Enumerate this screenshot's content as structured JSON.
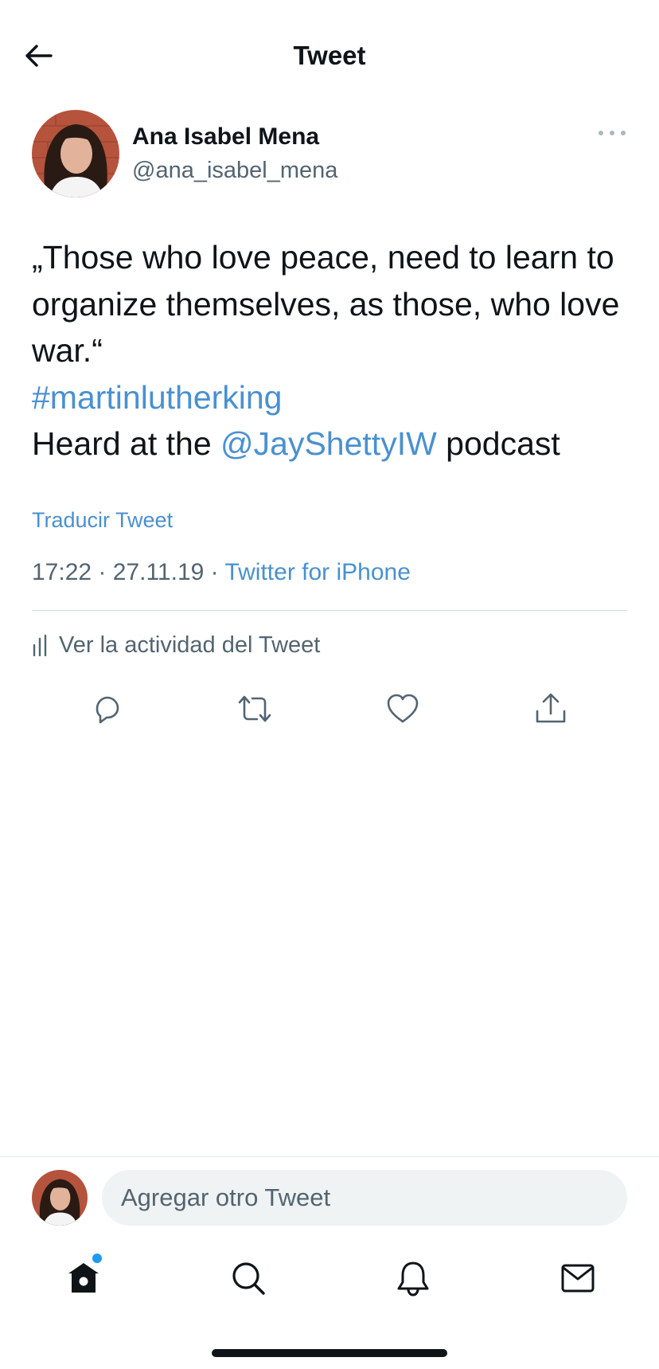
{
  "header": {
    "title": "Tweet"
  },
  "author": {
    "name": "Ana Isabel Mena",
    "handle": "@ana_isabel_mena"
  },
  "tweet": {
    "quote_line": "„Those who love peace, need to learn to organize themselves, as those, who love war.“",
    "hashtag": "#martinlutherking",
    "prefix": "Heard at the ",
    "mention": "@JayShettyIW",
    "suffix": " podcast"
  },
  "translate_label": "Traducir Tweet",
  "meta": {
    "time": "17:22",
    "separator": "·",
    "date": "27.11.19",
    "source": "Twitter for iPhone"
  },
  "activity_label": "Ver la actividad del Tweet",
  "composer": {
    "placeholder": "Agregar otro Tweet"
  },
  "icons": {
    "back": "arrow-left-icon",
    "more": "more-horizontal-icon",
    "activity": "bar-chart-icon",
    "reply": "reply-icon",
    "retweet": "retweet-icon",
    "like": "heart-icon",
    "share": "share-icon",
    "home": "home-icon",
    "search": "search-icon",
    "notifications": "bell-icon",
    "messages": "mail-icon"
  },
  "colors": {
    "link": "#4a90d0",
    "secondary_text": "#536471",
    "notification_dot": "#1d9bf0"
  }
}
